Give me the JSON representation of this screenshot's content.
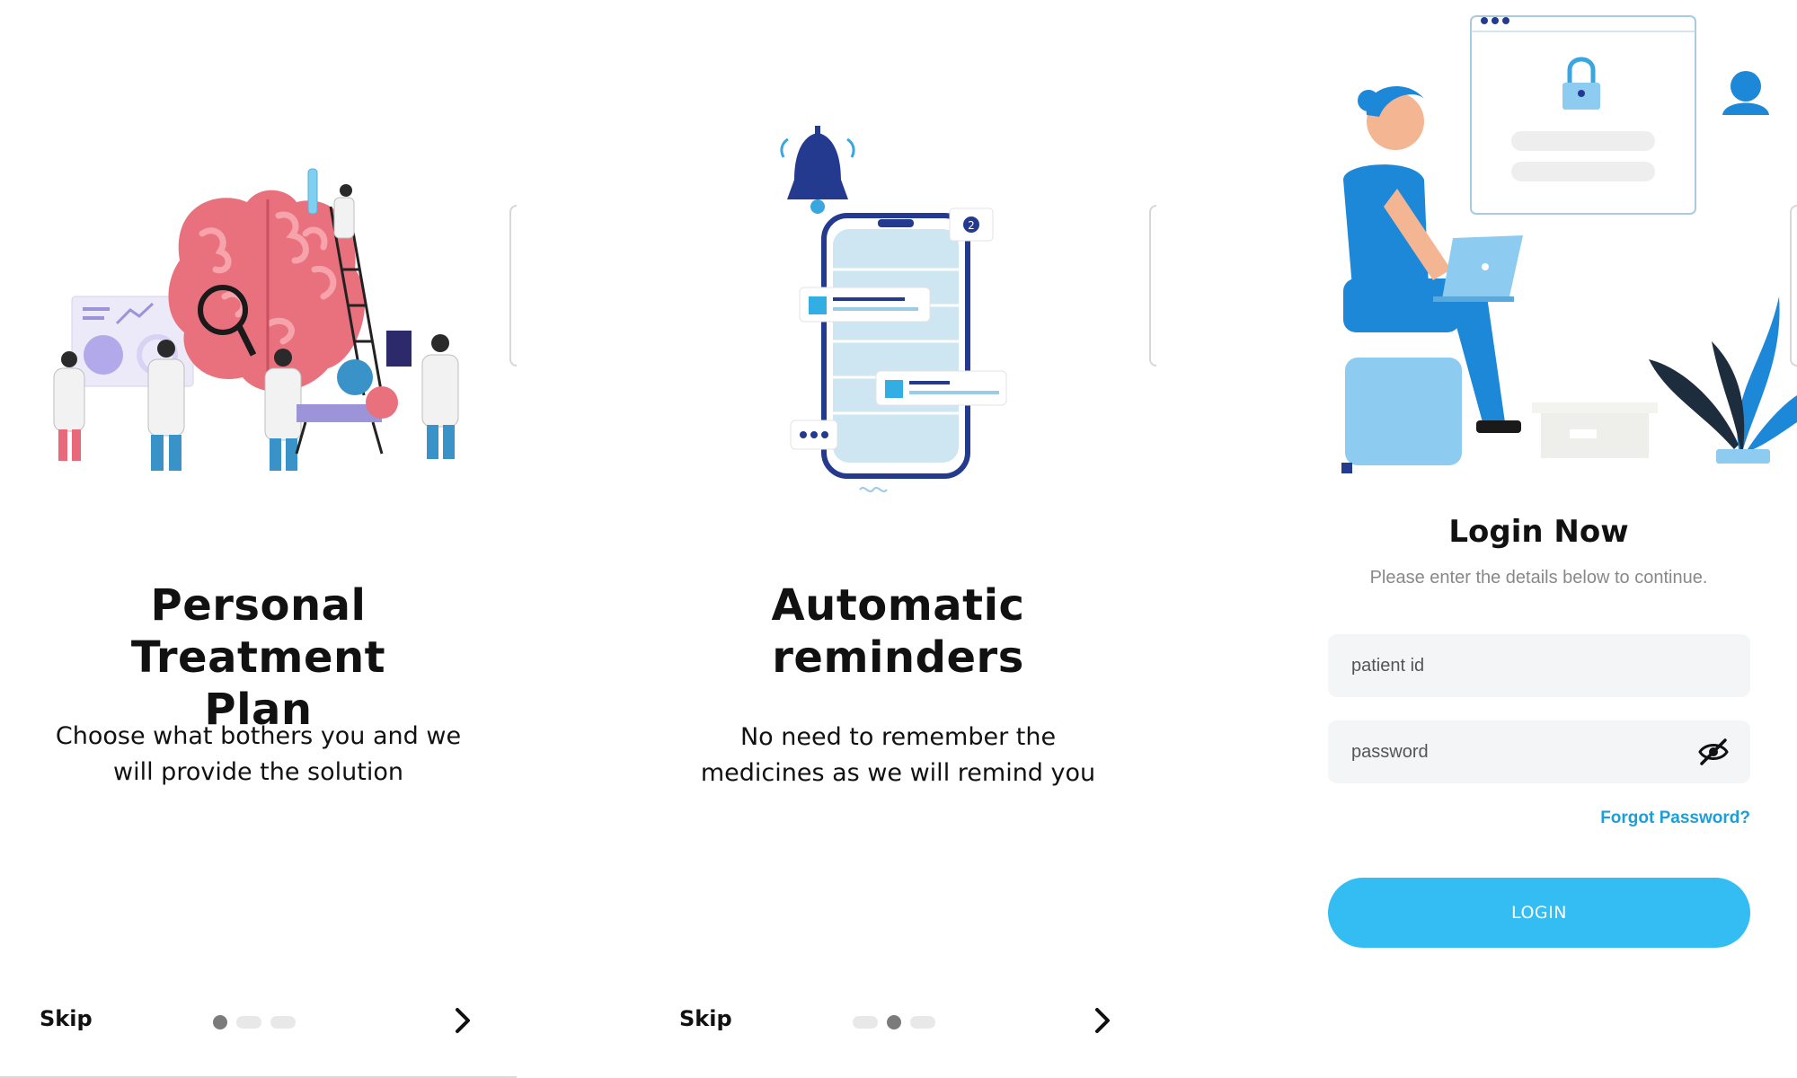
{
  "onboarding": [
    {
      "title_line1": "Personal Treatment",
      "title_line2": "Plan",
      "subtitle_line1": "Choose what bothers you and we",
      "subtitle_line2": "will provide the solution",
      "skip_label": "Skip",
      "active_page": 1
    },
    {
      "title_line1": "Automatic",
      "title_line2": "reminders",
      "subtitle_line1": "No need to remember the",
      "subtitle_line2": "medicines as we will remind you",
      "skip_label": "Skip",
      "active_page": 2
    }
  ],
  "illustration": {
    "chat_badge_count": "2"
  },
  "login": {
    "title": "Login Now",
    "subtitle": "Please enter the details below to continue.",
    "patient_id_placeholder": "patient id",
    "password_placeholder": "password",
    "forgot_label": "Forgot Password?",
    "login_button_label": "LOGIN"
  },
  "colors": {
    "accent": "#33bdf3",
    "link": "#1b9ed9",
    "brain": "#e9707d",
    "navy": "#243a8f",
    "blue": "#1e88d8"
  },
  "icons": [
    "chevron-right-icon",
    "eye-off-icon",
    "user-icon",
    "lock-icon",
    "bell-icon"
  ]
}
